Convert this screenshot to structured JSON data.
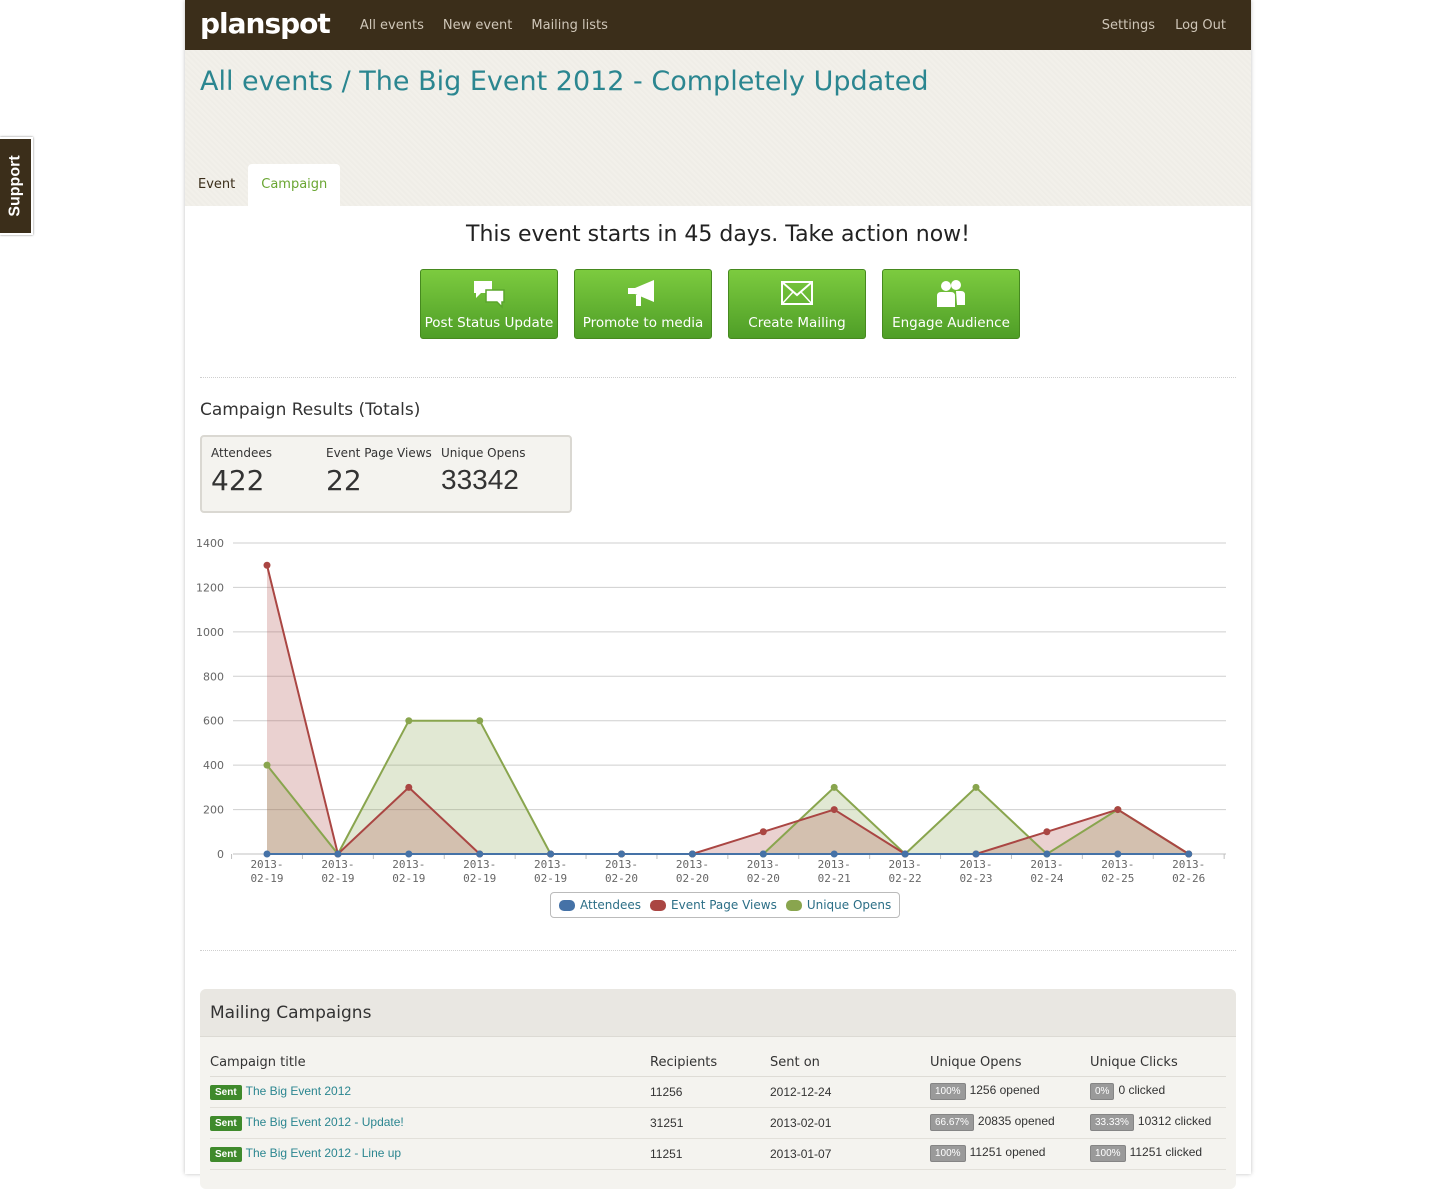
{
  "support_label": "Support",
  "nav": {
    "logo": "planspot",
    "links": [
      "All events",
      "New event",
      "Mailing lists"
    ],
    "right_links": [
      "Settings",
      "Log Out"
    ]
  },
  "header": {
    "title": "All events / The Big Event 2012 - Completely Updated",
    "tabs": [
      "Event",
      "Campaign"
    ],
    "active_tab": "Campaign"
  },
  "countdown": "This event starts in 45 days. Take action now!",
  "actions": [
    {
      "label": "Post Status Update",
      "icon": "speech-bubbles-icon"
    },
    {
      "label": "Promote to media",
      "icon": "megaphone-icon"
    },
    {
      "label": "Create Mailing",
      "icon": "envelope-icon"
    },
    {
      "label": "Engage Audience",
      "icon": "people-icon"
    }
  ],
  "results": {
    "title": "Campaign Results (Totals)",
    "totals": [
      {
        "label": "Attendees",
        "value": "422"
      },
      {
        "label": "Event Page Views",
        "value": "22"
      },
      {
        "label": "Unique Opens",
        "value": "33342"
      }
    ]
  },
  "chart_data": {
    "type": "area",
    "x": [
      "2013-02-19",
      "2013-02-19",
      "2013-02-19",
      "2013-02-19",
      "2013-02-19",
      "2013-02-20",
      "2013-02-20",
      "2013-02-20",
      "2013-02-21",
      "2013-02-22",
      "2013-02-23",
      "2013-02-24",
      "2013-02-25",
      "2013-02-26"
    ],
    "ylim": [
      0,
      1400
    ],
    "yticks": [
      0,
      200,
      400,
      600,
      800,
      1000,
      1200,
      1400
    ],
    "grid": true,
    "legend_position": "bottom-center",
    "series": [
      {
        "name": "Attendees",
        "color": "#4572a7",
        "values": [
          0,
          0,
          0,
          0,
          0,
          0,
          0,
          0,
          0,
          0,
          0,
          0,
          0,
          0
        ]
      },
      {
        "name": "Event Page Views",
        "color": "#aa4643",
        "values": [
          1300,
          0,
          300,
          0,
          0,
          0,
          0,
          100,
          200,
          0,
          0,
          100,
          200,
          0
        ]
      },
      {
        "name": "Unique Opens",
        "color": "#89a54e",
        "values": [
          400,
          0,
          600,
          600,
          0,
          0,
          0,
          0,
          300,
          0,
          300,
          0,
          200,
          0
        ]
      }
    ]
  },
  "mailing": {
    "title": "Mailing Campaigns",
    "headers": [
      "Campaign title",
      "Recipients",
      "Sent on",
      "Unique Opens",
      "Unique Clicks"
    ],
    "rows": [
      {
        "status": "Sent",
        "title": "The Big Event 2012",
        "recipients": "11256",
        "sent_on": "2012-12-24",
        "open_pct": "100%",
        "opened": "1256  opened",
        "click_pct": "0%",
        "clicked": "0 clicked"
      },
      {
        "status": "Sent",
        "title": "The Big Event 2012 - Update!",
        "recipients": "31251",
        "sent_on": "2013-02-01",
        "open_pct": "66.67%",
        "opened": "20835  opened",
        "click_pct": "33.33%",
        "clicked": "10312  clicked"
      },
      {
        "status": "Sent",
        "title": "The Big Event 2012 - Line up",
        "recipients": "11251",
        "sent_on": "2013-01-07",
        "open_pct": "100%",
        "opened": "11251  opened",
        "click_pct": "100%",
        "clicked": "11251 clicked"
      }
    ]
  }
}
